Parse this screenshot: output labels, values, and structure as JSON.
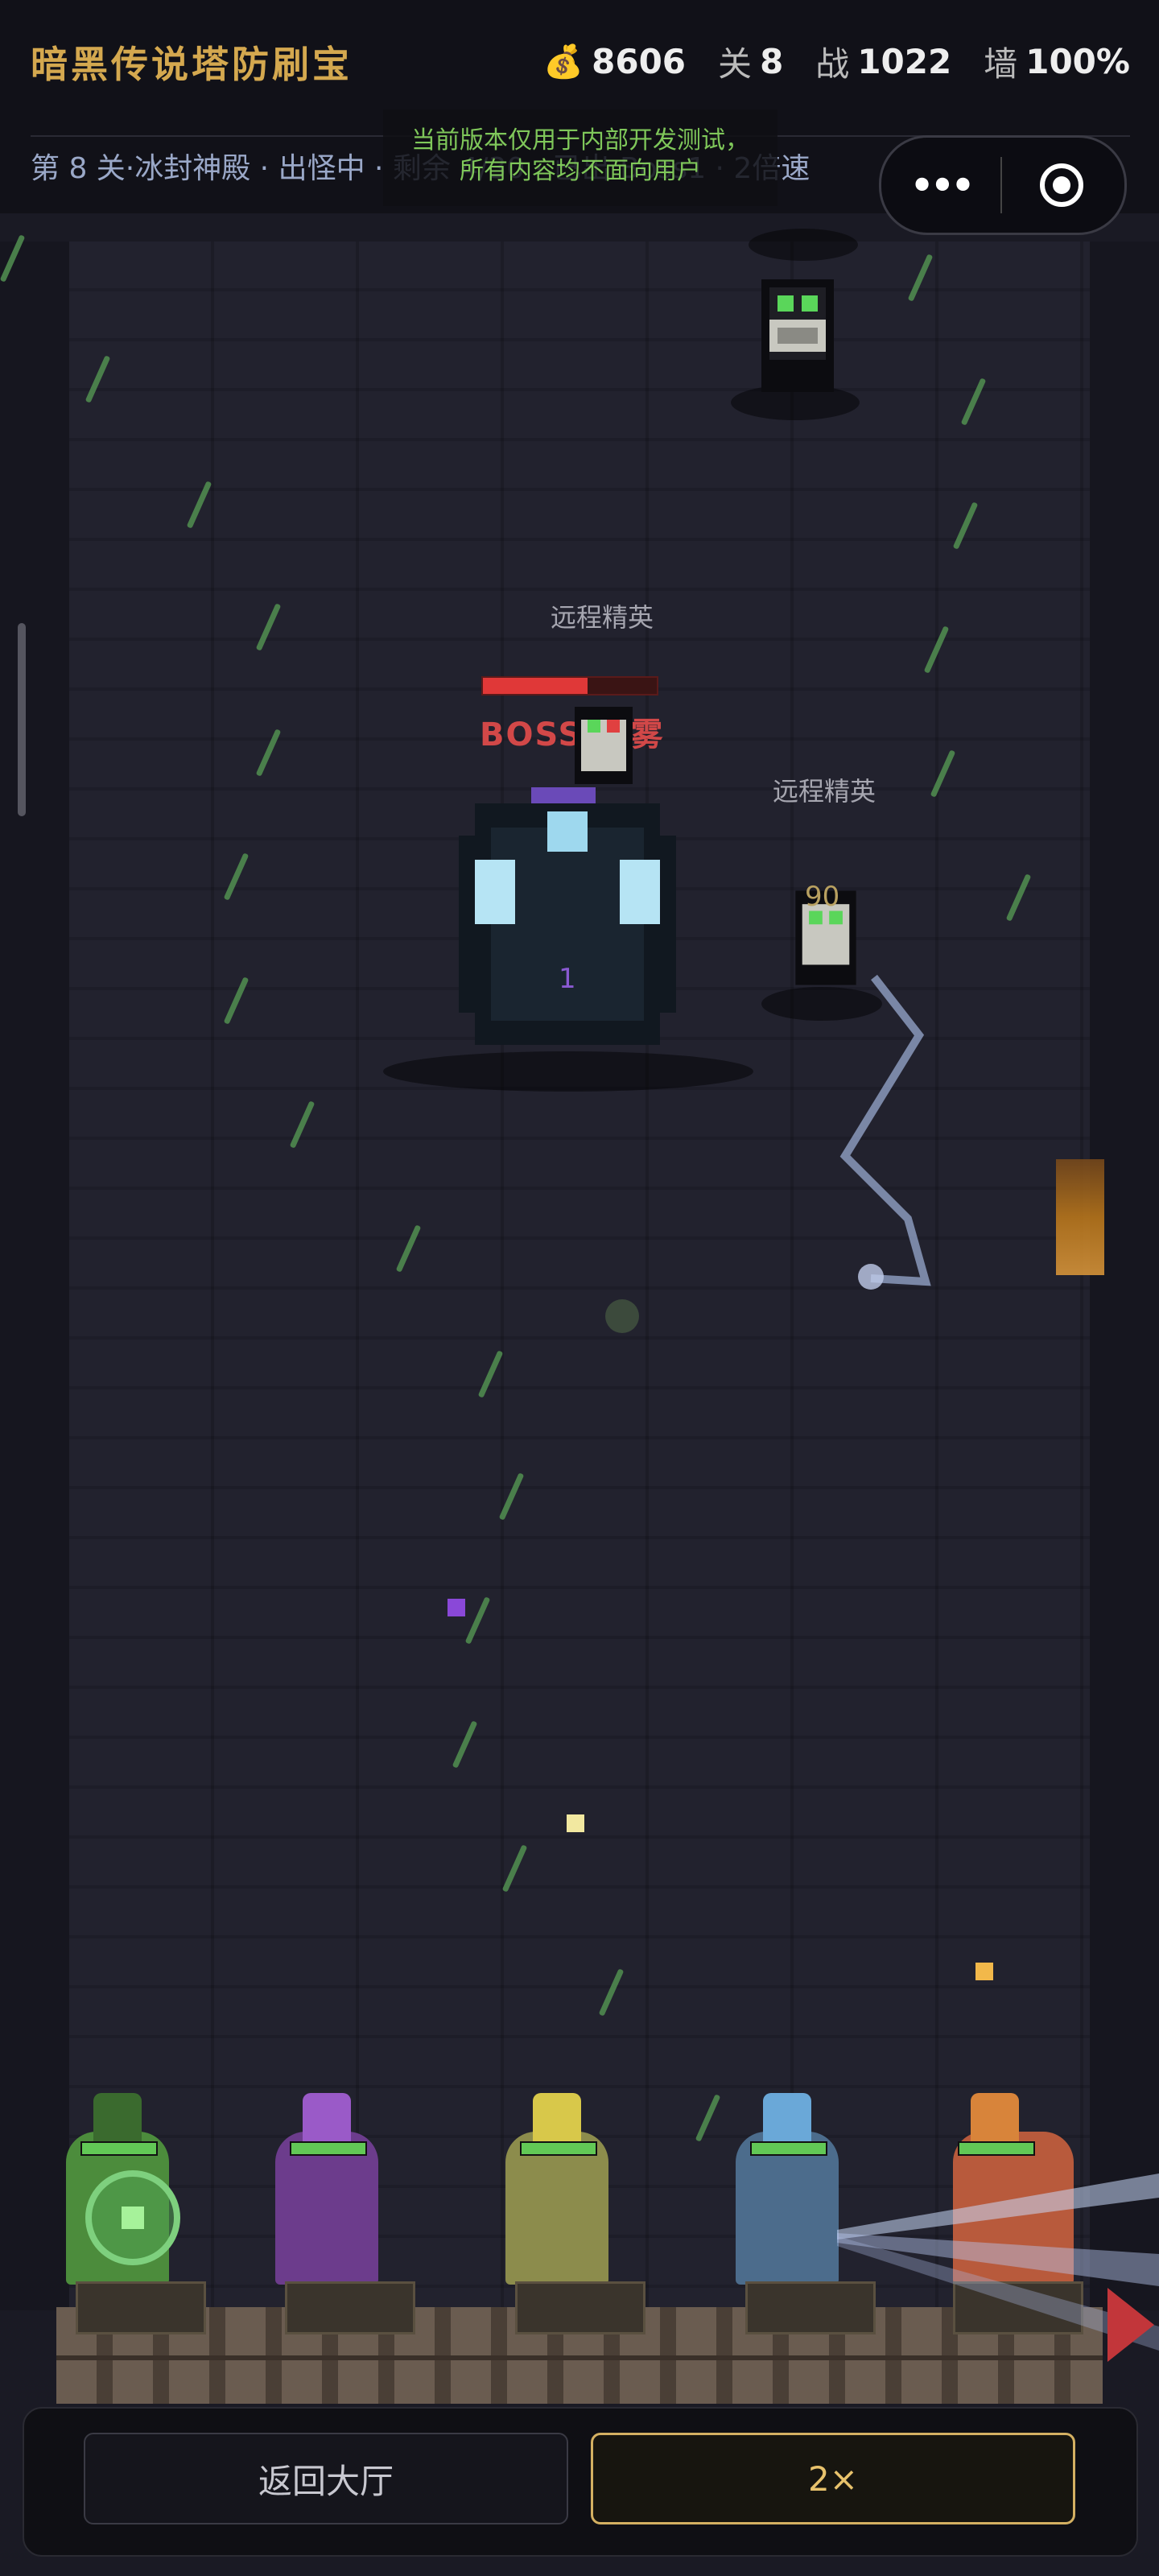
{
  "header": {
    "title": "暗黑传说塔防刷宝",
    "gold": "8606",
    "stage_label": "关",
    "stage": "8",
    "power_label": "战",
    "power": "1022",
    "wall_label": "墙",
    "wall": "100%",
    "status_line": "第 8 关·冰封神殿 · 出怪中 · 剩余 4/30 · 已出 Boss1 · 2倍速",
    "dev_notice_line1": "当前版本仅用于内部开发测试，",
    "dev_notice_line2": "所有内容均不面向用户"
  },
  "miniprogram": {
    "more_label": "•••"
  },
  "battlefield": {
    "elite_label_1": "远程精英",
    "elite_label_2": "远程精英",
    "boss_label": "BOSS·毒雾",
    "boss_hp": 0.6,
    "boss_damage_text": "1",
    "elite_damage_text": "90"
  },
  "towers": [
    {
      "name": "green",
      "color": "#4c8c3c"
    },
    {
      "name": "purple",
      "color": "#6c3c8c"
    },
    {
      "name": "yellow",
      "color": "#8c8c4c"
    },
    {
      "name": "blue",
      "color": "#4c6c8c"
    },
    {
      "name": "red",
      "color": "#b85a3c"
    }
  ],
  "buttons": {
    "lobby": "返回大厅",
    "speed": "2×"
  }
}
